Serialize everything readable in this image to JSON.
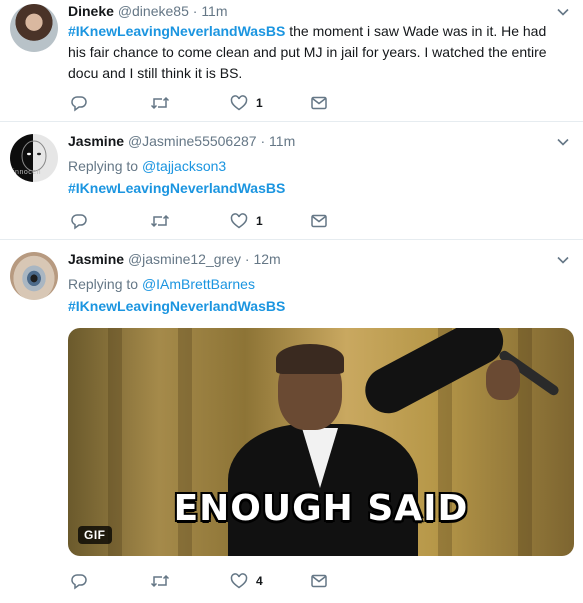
{
  "colors": {
    "link": "#1b95e0",
    "muted": "#657786",
    "text": "#14171a",
    "divider": "#e6ecf0"
  },
  "tweets": [
    {
      "name": "Dineke",
      "handle": "@dineke85",
      "separator": "·",
      "time": "11m",
      "hashtag": "#IKnewLeavingNeverlandWasBS",
      "text": " the  moment i saw Wade was in it. He had his fair chance to come clean and put MJ in jail for years. I watched the entire docu and I still think it is BS.",
      "likes": "1",
      "avatar_icon": "avatar-woman-photo"
    },
    {
      "name": "Jasmine",
      "handle": "@Jasmine55506287",
      "separator": "·",
      "time": "11m",
      "replying_prefix": "Replying to ",
      "replying_to": "@tajjackson3",
      "hashtag": "#IKnewLeavingNeverlandWasBS",
      "likes": "1",
      "avatar_icon": "avatar-black-white-face",
      "avatar_text": "innocen"
    },
    {
      "name": "Jasmine",
      "handle": "@jasmine12_grey",
      "separator": "·",
      "time": "12m",
      "replying_prefix": "Replying to ",
      "replying_to": "@IAmBrettBarnes",
      "hashtag": "#IKnewLeavingNeverlandWasBS",
      "likes": "4",
      "avatar_icon": "avatar-eye-closeup",
      "media": {
        "caption": "ENOUGH SAID",
        "badge": "GIF"
      }
    }
  ]
}
